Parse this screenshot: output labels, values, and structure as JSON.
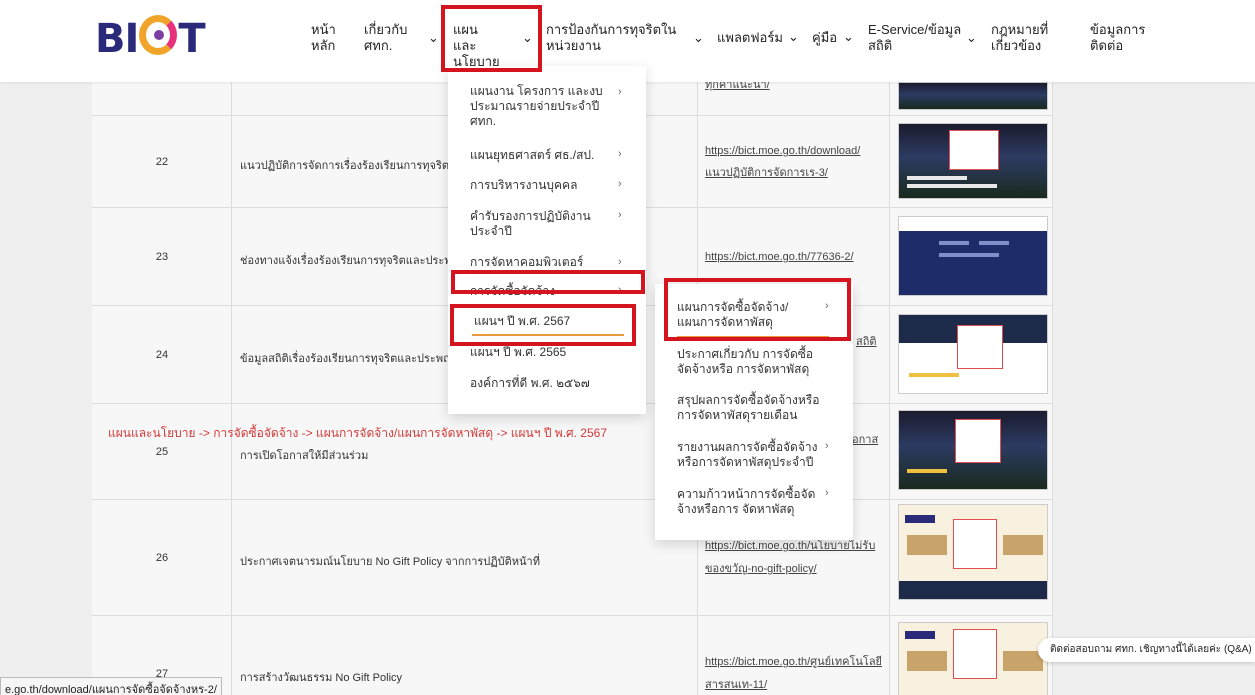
{
  "logo": {
    "text_b": "B",
    "text_i": "I",
    "text_t": "T"
  },
  "nav": {
    "home": "หน้าหลัก",
    "about": "เกี่ยวกับ ศทก.",
    "plans": "แผนและนโยบาย",
    "anticorruption": "การป้องกันการทุจริตในหน่วยงาน",
    "platform": "แพลตฟอร์ม",
    "manual": "คู่มือ",
    "eservice": "E-Service/ข้อมูลสถิติ",
    "law": "กฎหมายที่เกี่ยวข้อง",
    "contact": "ข้อมูลการติดต่อ"
  },
  "menu_plans": {
    "items": [
      "แผนงาน โครงการ และงบประมาณรายจ่ายประจำปี ศทก.",
      "แผนยุทธศาสตร์ ศธ./สป.",
      "การบริหารงานบุคคล",
      "คำรับรองการปฏิบัติงานประจำปี",
      "การจัดหาคอมพิวเตอร์",
      "การจัดซื้อจัดจ้าง",
      "แผนฯ ปี พ.ศ. 2567",
      "แผนฯ ปี พ.ศ. 2565",
      "องค์การที่ดี พ.ศ. ๒๕๖๗"
    ]
  },
  "menu_procurement": {
    "items": [
      "แผนการจัดซื้อจัดจ้าง/แผนการจัดหาพัสดุ",
      "ประกาศเกี่ยวกับ การจัดซื้อจัดจ้างหรือ การจัดหาพัสดุ",
      "สรุปผลการจัดซื้อจัดจ้างหรือการจัดหาพัสดุรายเดือน",
      "รายงานผลการจัดซื้อจัดจ้างหรือการจัดหาพัสดุประจำปี",
      "ความก้าวหน้าการจัดซื้อจัดจ้างหรือการ จัดหาพัสดุ"
    ]
  },
  "rows": [
    {
      "num": "",
      "title": "",
      "link1": "ทุกคำแนะนำ/",
      "link2": ""
    },
    {
      "num": "22",
      "title": "แนวปฏิบัติการจัดการเรื่องร้องเรียนการทุจริตและ",
      "link1": "https://bict.moe.go.th/download/",
      "link2": "แนวปฏิบัติการจัดการเร-3/"
    },
    {
      "num": "23",
      "title": "ช่องทางแจ้งเรื่องร้องเรียนการทุจริตและประพฤติ",
      "link1": "https://bict.moe.go.th/77636-2/",
      "link2": ""
    },
    {
      "num": "24",
      "title": "ข้อมูลสถิติเรื่องร้องเรียนการทุจริตและประพฤติมิ",
      "link1": "สถิติ",
      "link2": ""
    },
    {
      "num": "25",
      "title": "การเปิดโอกาสให้มีส่วนร่วม",
      "link1": "อกาส",
      "link2": ""
    },
    {
      "num": "26",
      "title": "ประกาศเจตนารมณ์นโยบาย No Gift Policy จากการปฏิบัติหน้าที่",
      "link1": "https://bict.moe.go.th/นโยบายไม่รับ",
      "link2": "ของขวัญ-no-gift-policy/"
    },
    {
      "num": "27",
      "title": "การสร้างวัฒนธรรม No Gift Policy",
      "link1": "https://bict.moe.go.th/ศูนย์เทคโนโลยี",
      "link2": "สารสนเท-11/"
    }
  ],
  "caption": "แผนและนโยบาย -> การจัดซื้อจัดจ้าง -> แผนการจัดจ้าง/แผนการจัดหาพัสดุ -> แผนฯ ปี พ.ศ. 2567",
  "status_url": "e.go.th/download/แผนการจัดซื้อจัดจ้างหร-2/",
  "chat": "ติดต่อสอบถาม ศทก. เชิญทางนี้ได้เลยค่ะ (Q&A)",
  "colors": {
    "accent": "#d4141e",
    "link_underline": "#e89a3c",
    "caption": "#d43a3a"
  }
}
